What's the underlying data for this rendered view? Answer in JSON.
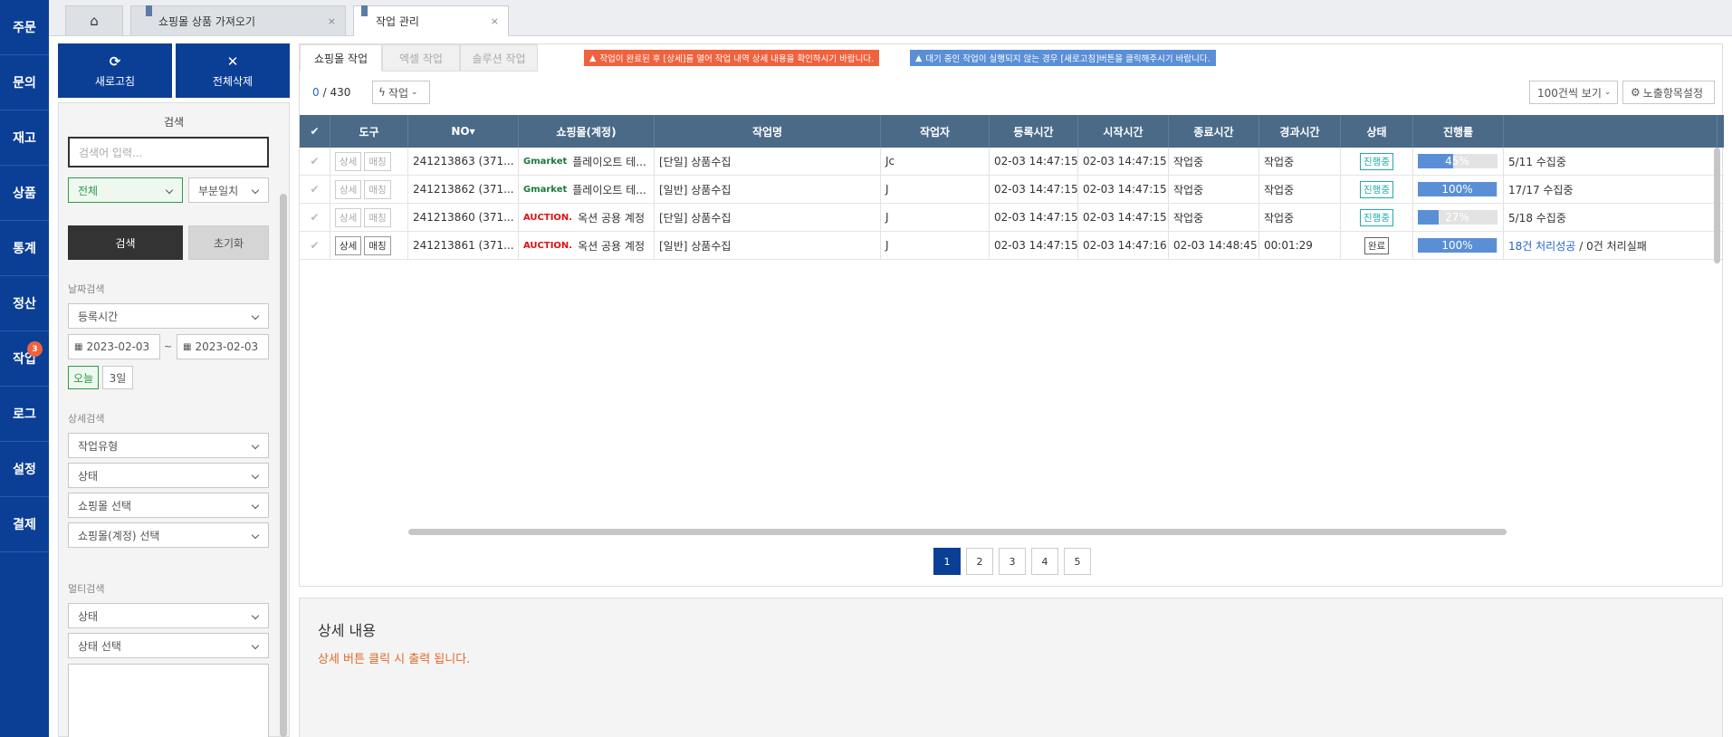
{
  "nav": [
    "주문",
    "문의",
    "재고",
    "상품",
    "통계",
    "정산",
    "작업",
    "로그",
    "설정",
    "결제"
  ],
  "nav_badge": "3",
  "tabs": {
    "shop_import": "쇼핑몰 상품 가져오기",
    "job_manage": "작업 관리",
    "close": "×"
  },
  "side": {
    "refresh": "새로고침",
    "delete_all": "전체삭제",
    "search_title": "검색",
    "search_placeholder": "검색어 입력...",
    "scope": "전체",
    "match": "부분일치",
    "search_btn": "검색",
    "reset_btn": "초기화",
    "date_label": "날짜검색",
    "date_type": "등록시간",
    "date_from": "2023-02-03",
    "date_to": "2023-02-03",
    "tilde": "~",
    "today": "오늘",
    "three_days": "3일",
    "detail_label": "상세검색",
    "job_type": "작업유형",
    "status": "상태",
    "mall_select": "쇼핑몰 선택",
    "account_select": "쇼핑몰(계정) 선택",
    "multi_label": "멀티검색",
    "multi_status": "상태",
    "multi_status_select": "상태 선택"
  },
  "main": {
    "tab_shop": "쇼핑몰 작업",
    "tab_excel": "엑셀 작업",
    "tab_solution": "솔루션 작업",
    "notice1": "작업이 완료된 후 [상세]를 열어 작업 내역 상세 내용을 확인하시기 바랍니다.",
    "notice2": "대기 중인 작업이 실행되지 않는 경우 [새로고침]버튼을 클릭해주시기 바랍니다.",
    "count_current": "0",
    "count_total": "/ 430",
    "action": "작업",
    "per_page": "100건씩 보기",
    "columns_setting": "노출항목설정"
  },
  "headers": [
    "",
    "도구",
    "NO",
    "쇼핑몰(계정)",
    "작업명",
    "작업자",
    "등록시간",
    "시작시간",
    "종료시간",
    "경과시간",
    "상태",
    "진행률",
    ""
  ],
  "rows": [
    {
      "detail": "상세",
      "match": "매칭",
      "no": "241213863 (371...",
      "mall_logo": "Gmarket",
      "mall": "플레이오트 테...",
      "job": "[단일] 상품수집",
      "worker": "Jc",
      "reg": "02-03 14:47:15",
      "start": "02-03 14:47:15",
      "end": "작업중",
      "elapsed": "작업중",
      "status": "진행중",
      "progress": 45,
      "progress_label": "45%",
      "result": "5/11 수집중",
      "result_fail": ""
    },
    {
      "detail": "상세",
      "match": "매칭",
      "no": "241213862 (371...",
      "mall_logo": "Gmarket",
      "mall": "플레이오트 테...",
      "job": "[일반] 상품수집",
      "worker": "J",
      "reg": "02-03 14:47:15",
      "start": "02-03 14:47:15",
      "end": "작업중",
      "elapsed": "작업중",
      "status": "진행중",
      "progress": 100,
      "progress_label": "100%",
      "result": "17/17 수집중",
      "result_fail": ""
    },
    {
      "detail": "상세",
      "match": "매칭",
      "no": "241213860 (371...",
      "mall_logo": "AUCTION.",
      "mall": "옥션 공용 계정",
      "job": "[단일] 상품수집",
      "worker": "J",
      "reg": "02-03 14:47:15",
      "start": "02-03 14:47:15",
      "end": "작업중",
      "elapsed": "작업중",
      "status": "진행중",
      "progress": 27,
      "progress_label": "27%",
      "result": "5/18 수집중",
      "result_fail": ""
    },
    {
      "detail": "상세",
      "match": "매칭",
      "no": "241213861 (371...",
      "mall_logo": "AUCTION.",
      "mall": "옥션 공용 계정",
      "job": "[일반] 상품수집",
      "worker": "J",
      "reg": "02-03 14:47:15",
      "start": "02-03 14:47:16",
      "end": "02-03 14:48:45",
      "elapsed": "00:01:29",
      "status": "완료",
      "progress": 100,
      "progress_label": "100%",
      "result": "18건 처리성공",
      "result_fail": "/ 0건 처리실패"
    }
  ],
  "pages": [
    "1",
    "2",
    "3",
    "4",
    "5"
  ],
  "detail": {
    "title": "상세 내용",
    "hint": "상세 버튼 클릭 시 출력 됩니다."
  },
  "colors": {
    "nav": "#0b3f96",
    "header": "#4a6a88",
    "accent": "#f0623e"
  }
}
